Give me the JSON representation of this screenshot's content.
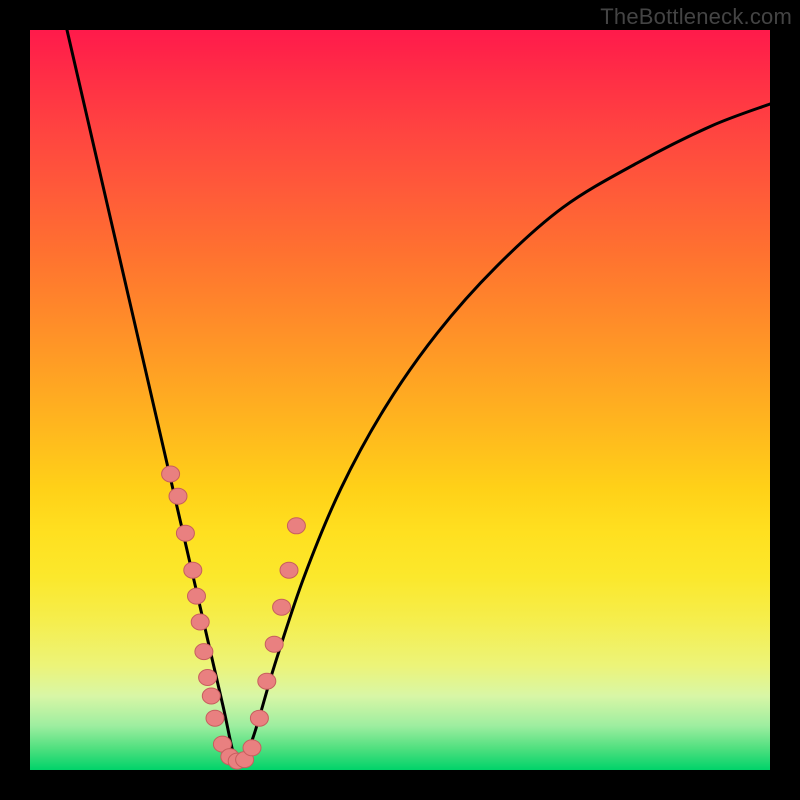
{
  "watermark": "TheBottleneck.com",
  "colors": {
    "curve": "#000000",
    "dot_fill": "#e98080",
    "dot_stroke": "#c75e5e",
    "frame": "#000000"
  },
  "chart_data": {
    "type": "line",
    "title": "",
    "xlabel": "",
    "ylabel": "",
    "xlim": [
      0,
      100
    ],
    "ylim": [
      0,
      100
    ],
    "grid": false,
    "legend": false,
    "description": "V-shaped bottleneck curve over a vertical red-to-green gradient. Lower y values (green) are better. Minimum near x≈28. Scattered data points cluster along the curve on both flanks and at the trough.",
    "series": [
      {
        "name": "bottleneck-curve",
        "type": "line",
        "x": [
          5,
          8,
          11,
          14,
          17,
          20,
          23,
          26,
          28,
          30,
          33,
          37,
          42,
          48,
          55,
          63,
          72,
          82,
          92,
          100
        ],
        "y": [
          100,
          87,
          74,
          61,
          48,
          35,
          22,
          9,
          1,
          4,
          14,
          26,
          38,
          49,
          59,
          68,
          76,
          82,
          87,
          90
        ]
      },
      {
        "name": "data-points",
        "type": "scatter",
        "x": [
          19,
          20,
          21,
          22,
          22.5,
          23,
          23.5,
          24,
          24.5,
          25,
          26,
          27,
          28,
          29,
          30,
          31,
          32,
          33,
          34,
          35,
          36
        ],
        "y": [
          40,
          37,
          32,
          27,
          23.5,
          20,
          16,
          12.5,
          10,
          7,
          3.5,
          1.8,
          1.2,
          1.4,
          3,
          7,
          12,
          17,
          22,
          27,
          33
        ]
      }
    ]
  }
}
